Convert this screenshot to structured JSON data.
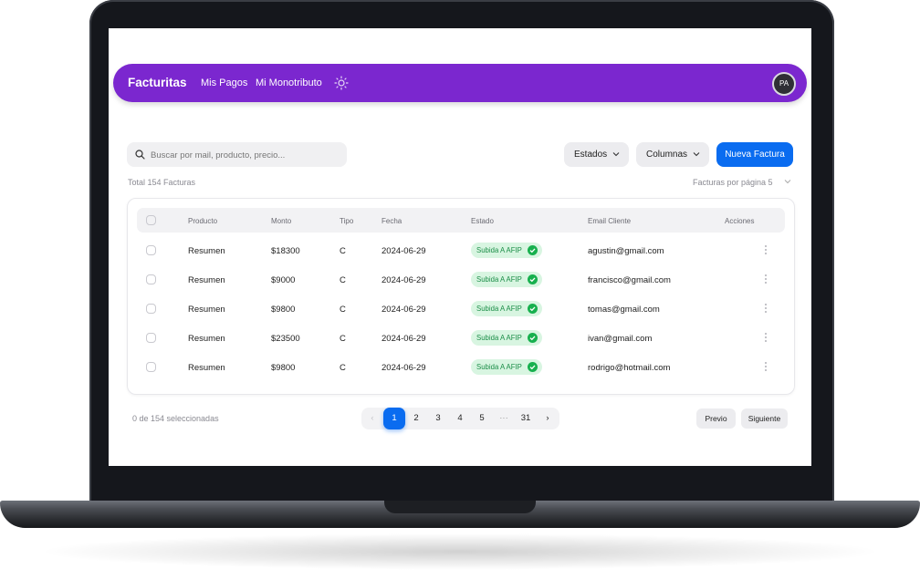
{
  "nav": {
    "brand": "Facturitas",
    "links": [
      "Mis Pagos",
      "Mi Monotributo"
    ],
    "avatar": "PA",
    "color": "#7b27cf"
  },
  "toolbar": {
    "search_placeholder": "Buscar por mail, producto, precio...",
    "estados_label": "Estados",
    "columnas_label": "Columnas",
    "nueva_label": "Nueva Factura",
    "accent": "#0a6cf0"
  },
  "summary": {
    "total": "Total 154 Facturas",
    "per_page": "Facturas por página 5"
  },
  "table": {
    "headers": [
      "Producto",
      "Monto",
      "Tipo",
      "Fecha",
      "Estado",
      "Email Cliente",
      "Acciones"
    ],
    "rows": [
      {
        "producto": "Resumen",
        "monto": "$18300",
        "tipo": "C",
        "fecha": "2024-06-29",
        "estado": "Subida A AFIP",
        "email": "agustin@gmail.com"
      },
      {
        "producto": "Resumen",
        "monto": "$9000",
        "tipo": "C",
        "fecha": "2024-06-29",
        "estado": "Subida A AFIP",
        "email": "francisco@gmail.com"
      },
      {
        "producto": "Resumen",
        "monto": "$9800",
        "tipo": "C",
        "fecha": "2024-06-29",
        "estado": "Subida A AFIP",
        "email": "tomas@gmail.com"
      },
      {
        "producto": "Resumen",
        "monto": "$23500",
        "tipo": "C",
        "fecha": "2024-06-29",
        "estado": "Subida A AFIP",
        "email": "ivan@gmail.com"
      },
      {
        "producto": "Resumen",
        "monto": "$9800",
        "tipo": "C",
        "fecha": "2024-06-29",
        "estado": "Subida A AFIP",
        "email": "rodrigo@hotmail.com"
      }
    ]
  },
  "footer": {
    "selected": "0 de 154 seleccionadas",
    "pages": [
      "1",
      "2",
      "3",
      "4",
      "5",
      "···",
      "31"
    ],
    "prev_arrow": "‹",
    "next_arrow": "›",
    "prev_label": "Previo",
    "next_label": "Siguiente"
  }
}
